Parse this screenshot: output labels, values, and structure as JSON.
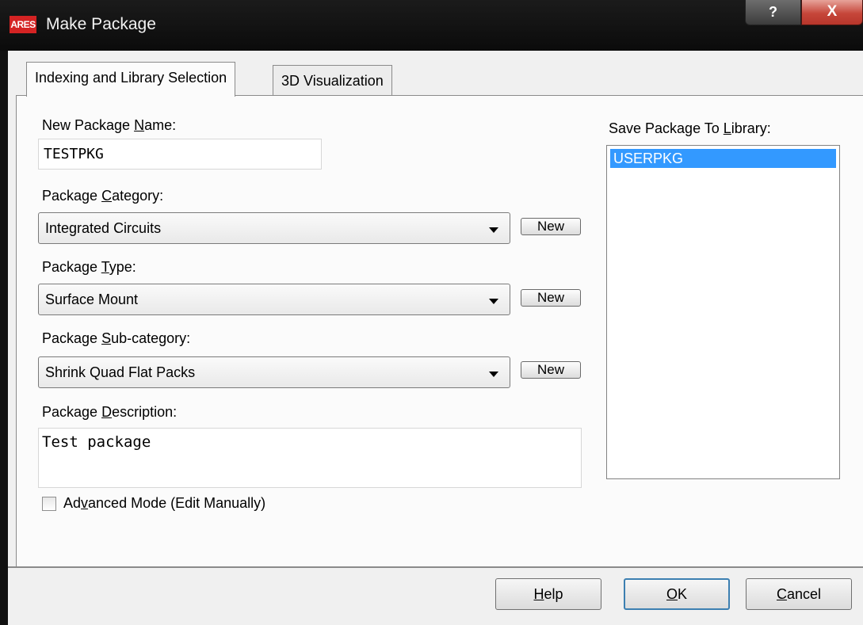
{
  "window": {
    "title": "Make Package",
    "app_icon_text": "ARES",
    "help_button": "?",
    "close_button": "X"
  },
  "tabs": [
    {
      "label": "Indexing and Library Selection",
      "active": true
    },
    {
      "label": "3D Visualization",
      "active": false
    }
  ],
  "form": {
    "name": {
      "label_pre": "New Package ",
      "label_key": "N",
      "label_post": "ame:",
      "value": "TESTPKG"
    },
    "category": {
      "label_pre": "Package ",
      "label_key": "C",
      "label_post": "ategory:",
      "value": "Integrated Circuits",
      "new_button": "New"
    },
    "type": {
      "label_pre": "Package ",
      "label_key": "T",
      "label_post": "ype:",
      "value": "Surface Mount",
      "new_button": "New"
    },
    "subcategory": {
      "label_pre": "Package ",
      "label_key": "S",
      "label_post": "ub-category:",
      "value": "Shrink Quad Flat Packs",
      "new_button": "New"
    },
    "description": {
      "label_pre": "Package ",
      "label_key": "D",
      "label_post": "escription:",
      "value": "Test package"
    },
    "advanced_mode": {
      "label_pre": "Ad",
      "label_key": "v",
      "label_post": "anced Mode (Edit Manually)",
      "checked": false
    }
  },
  "library": {
    "label_pre": "Save Package To ",
    "label_key": "L",
    "label_post": "ibrary:",
    "items": [
      "USERPKG"
    ],
    "selected": "USERPKG"
  },
  "buttons": {
    "help": {
      "key": "H",
      "rest": "elp"
    },
    "ok": {
      "key": "O",
      "rest": "K"
    },
    "cancel": {
      "key": "C",
      "rest": "ancel"
    }
  },
  "colors": {
    "selection": "#3399ff",
    "titlebar": "#111111",
    "close_button": "#c6463a"
  }
}
